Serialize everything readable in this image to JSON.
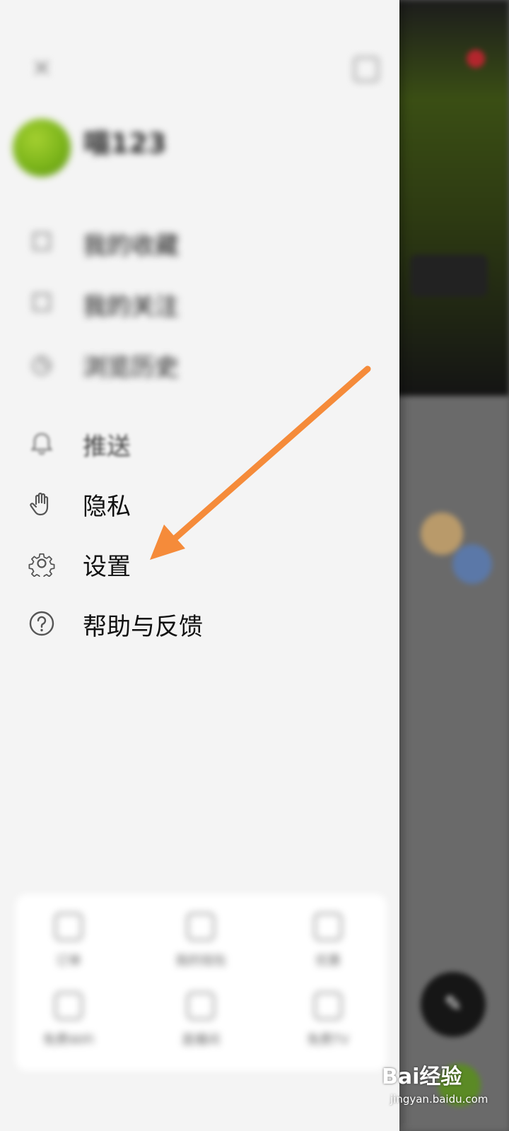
{
  "drawer": {
    "profile": {
      "name": "喵123",
      "subtitle": ""
    },
    "menu_blurred": [
      {
        "label": "我的收藏",
        "extra": "",
        "icon": "bookmark-icon"
      },
      {
        "label": "我的关注",
        "icon": "follow-icon"
      },
      {
        "label": "浏览历史",
        "icon": "history-icon"
      }
    ],
    "menu": [
      {
        "label": "推送",
        "icon": "bell-icon"
      },
      {
        "label": "隐私",
        "icon": "hand-icon"
      },
      {
        "label": "设置",
        "icon": "gear-icon"
      },
      {
        "label": "帮助与反馈",
        "icon": "help-icon"
      }
    ],
    "tools": [
      {
        "label": "订单",
        "icon": "order-icon"
      },
      {
        "label": "我的钱包",
        "icon": "wallet-icon"
      },
      {
        "label": "优惠",
        "icon": "coupon-icon"
      },
      {
        "label": "免费WiFi",
        "icon": "wifi-icon"
      },
      {
        "label": "直播间",
        "icon": "live-icon"
      },
      {
        "label": "免费TV",
        "icon": "tv-icon"
      }
    ]
  },
  "annotation": {
    "color": "#f58b3a",
    "target": "设置"
  },
  "watermark": {
    "main": "Bai经验",
    "sub": "jingyan.baidu.com"
  }
}
